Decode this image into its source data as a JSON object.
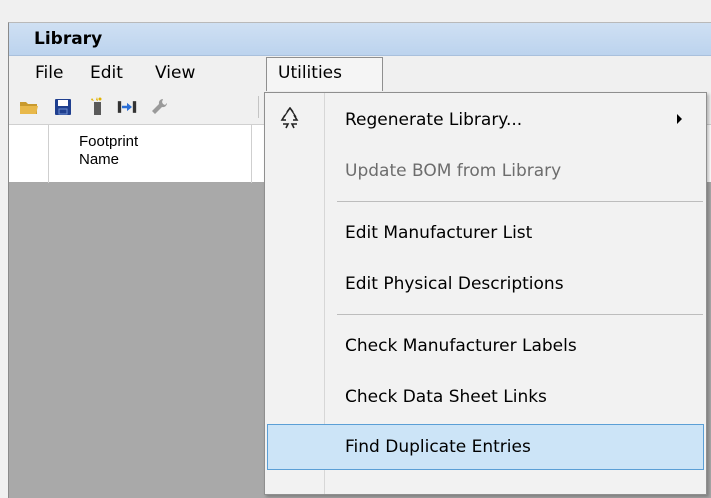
{
  "window": {
    "title": "Library"
  },
  "menubar": {
    "file": "File",
    "edit": "Edit",
    "view": "View",
    "utilities": "Utilities"
  },
  "toolbar": {
    "icons": [
      "open-folder-icon",
      "save-icon",
      "new-item-icon",
      "merge-icon",
      "wrench-icon"
    ]
  },
  "grid": {
    "column_header": "Footprint\nName",
    "column_header_line1": "Footprint",
    "column_header_line2": "Name"
  },
  "utilities_menu": {
    "items": [
      {
        "label": "Regenerate Library...",
        "has_submenu": true,
        "enabled": true,
        "icon": "recycle-icon"
      },
      {
        "label": "Update BOM from Library",
        "enabled": false
      },
      {
        "label": "Edit Manufacturer List",
        "enabled": true
      },
      {
        "label": "Edit Physical Descriptions",
        "enabled": true
      },
      {
        "label": "Check Manufacturer Labels",
        "enabled": true
      },
      {
        "label": "Check Data Sheet Links",
        "enabled": true
      },
      {
        "label": "Find Duplicate Entries",
        "enabled": true,
        "highlighted": true
      }
    ]
  },
  "colors": {
    "titlebar": "#bcd3ee",
    "highlight": "#cce4f7",
    "highlight_border": "#5b9fd6",
    "grid_background": "#a9a9a9",
    "disabled_text": "#6d6d6d"
  }
}
